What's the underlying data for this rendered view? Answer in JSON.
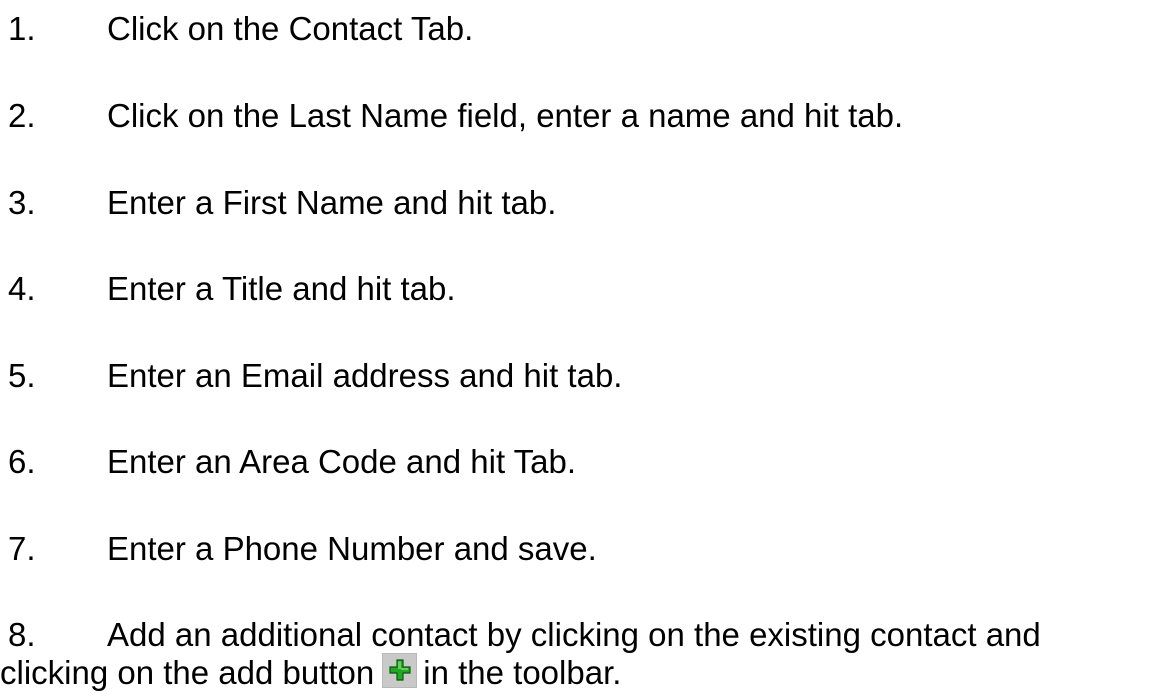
{
  "steps": [
    {
      "num": "1.",
      "text": "Click on the Contact Tab."
    },
    {
      "num": "2.",
      "text": "Click on the Last Name field, enter a name and hit tab."
    },
    {
      "num": "3.",
      "text": "Enter a First Name and hit tab."
    },
    {
      "num": "4.",
      "text": "Enter a Title and hit tab."
    },
    {
      "num": "5.",
      "text": "Enter an Email address and hit tab."
    },
    {
      "num": "6.",
      "text": "Enter an Area Code and hit Tab."
    },
    {
      "num": "7.",
      "text": "Enter a Phone Number and save."
    },
    {
      "num": "8.",
      "text_line1": "Add an additional contact by clicking on the existing contact and",
      "text_line2_before": "clicking on the add button",
      "icon": "add-plus-icon",
      "text_line2_after": "in the toolbar."
    }
  ],
  "colors": {
    "text": "#000000",
    "icon_bg": "#c9c9c9",
    "plus_green": "#22a822"
  }
}
